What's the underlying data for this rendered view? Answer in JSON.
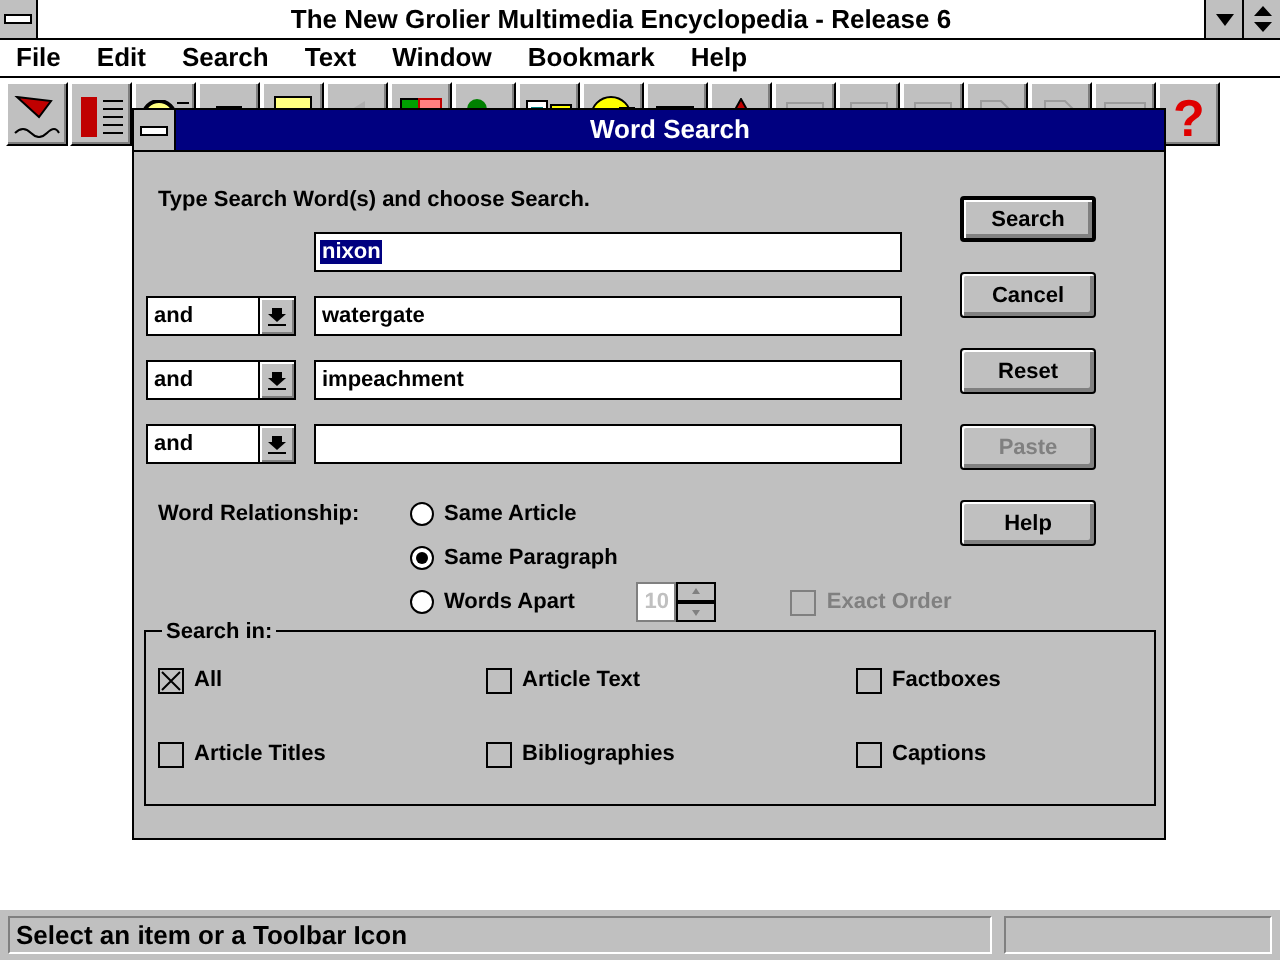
{
  "window": {
    "title": "The New Grolier Multimedia Encyclopedia - Release 6"
  },
  "menu": [
    "File",
    "Edit",
    "Search",
    "Text",
    "Window",
    "Bookmark",
    "Help"
  ],
  "toolbar": [
    {
      "disabled": false
    },
    {
      "disabled": false
    },
    {
      "disabled": false
    },
    {
      "disabled": false
    },
    {
      "disabled": false
    },
    {
      "disabled": true
    },
    {
      "disabled": false
    },
    {
      "disabled": false
    },
    {
      "disabled": false
    },
    {
      "disabled": false
    },
    {
      "disabled": false
    },
    {
      "disabled": false
    },
    {
      "disabled": true
    },
    {
      "disabled": true
    },
    {
      "disabled": true
    },
    {
      "disabled": true
    },
    {
      "disabled": true
    },
    {
      "disabled": true
    },
    {
      "disabled": false,
      "label": "?"
    }
  ],
  "dialog": {
    "title": "Word Search",
    "instruction": "Type Search Word(s) and choose Search.",
    "terms": [
      {
        "value": "nixon",
        "highlighted": true
      },
      {
        "operator": "and",
        "value": "watergate"
      },
      {
        "operator": "and",
        "value": "impeachment"
      },
      {
        "operator": "and"
      }
    ],
    "buttons": [
      {
        "label": "Search",
        "default": true,
        "disabled": false
      },
      {
        "label": "Cancel",
        "default": false,
        "disabled": false
      },
      {
        "label": "Reset",
        "default": false,
        "disabled": false
      },
      {
        "label": "Paste",
        "default": false,
        "disabled": true
      },
      {
        "label": "Help",
        "default": false,
        "disabled": false
      }
    ],
    "relationship": {
      "label": "Word Relationship:",
      "options": [
        {
          "label": "Same Article",
          "selected": false
        },
        {
          "label": "Same Paragraph",
          "selected": true
        },
        {
          "label": "Words Apart",
          "selected": false
        }
      ]
    },
    "words_apart": {
      "value": "10",
      "disabled": true
    },
    "exact_order": {
      "label": "Exact Order",
      "checked": false,
      "disabled": true
    },
    "search_in": {
      "label": "Search in:",
      "options": [
        {
          "label": "All",
          "checked": true
        },
        {
          "label": "Article Text",
          "checked": false
        },
        {
          "label": "Factboxes",
          "checked": false
        },
        {
          "label": "Article Titles",
          "checked": false
        },
        {
          "label": "Bibliographies",
          "checked": false
        },
        {
          "label": "Captions",
          "checked": false
        }
      ]
    }
  },
  "status_bar": {
    "message": "Select an item or a Toolbar Icon"
  }
}
